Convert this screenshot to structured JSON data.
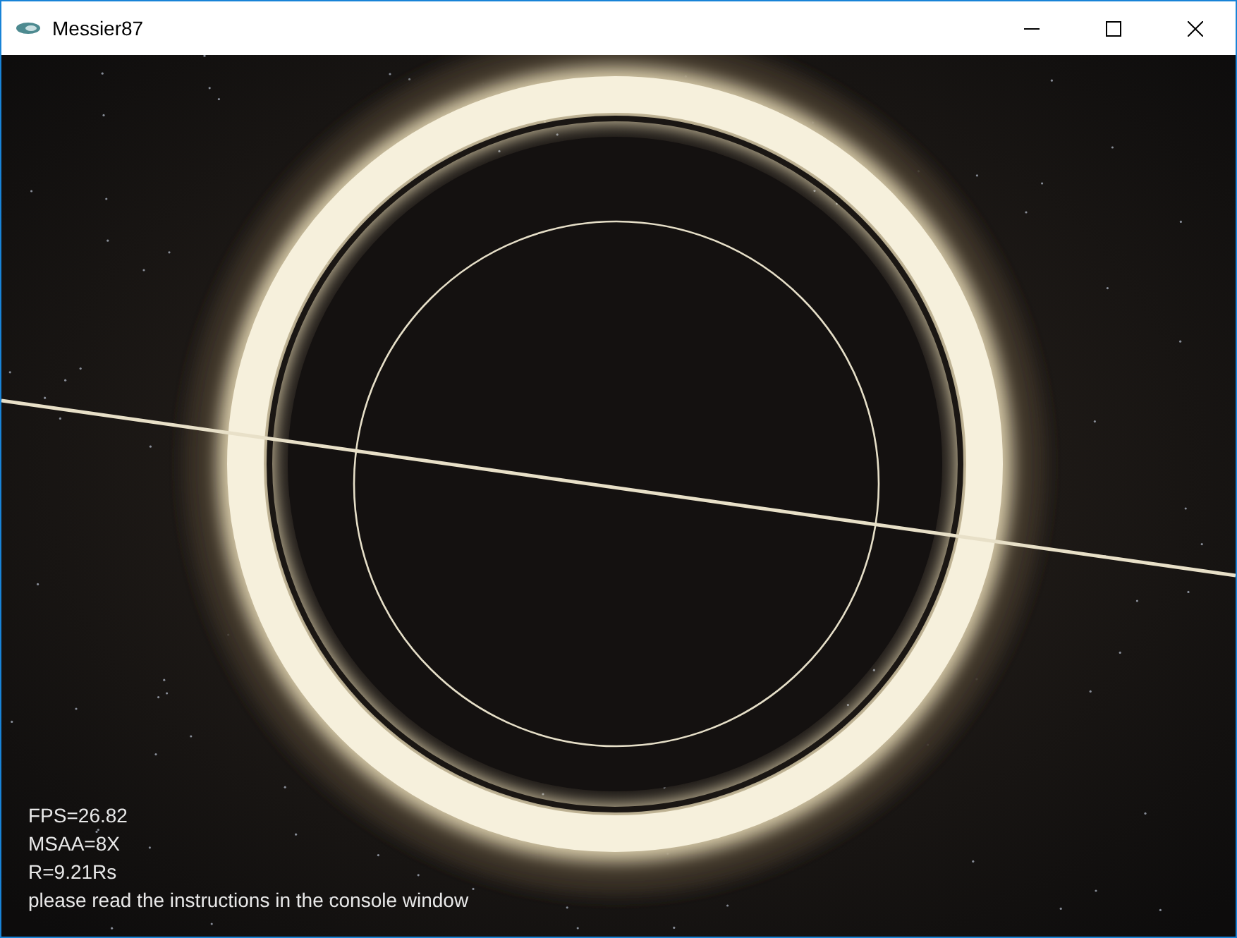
{
  "window": {
    "title": "Messier87"
  },
  "overlay_lines": [
    "FPS=26.82",
    "MSAA=8X",
    "R=9.21Rs",
    "please read the instructions in the console window"
  ]
}
